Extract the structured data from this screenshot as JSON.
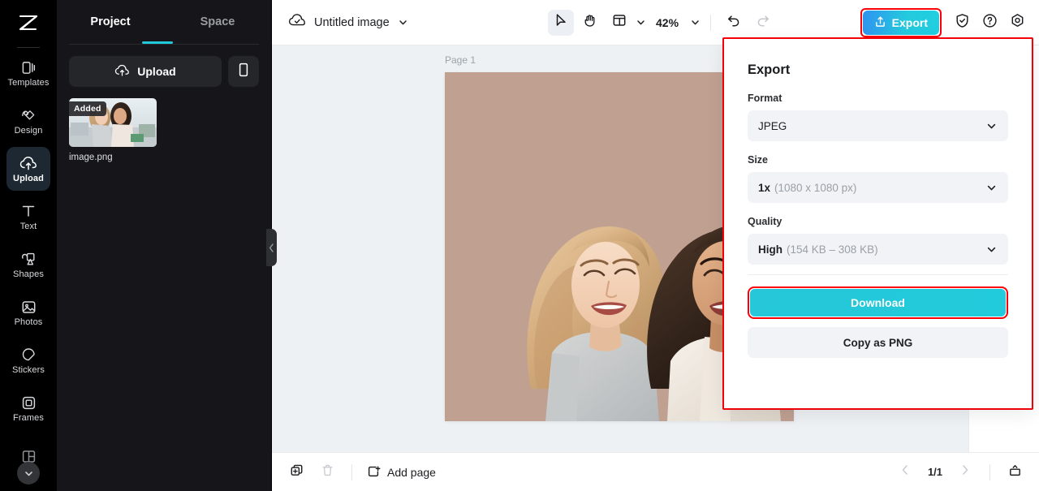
{
  "app": {
    "logo": "capcut-logo",
    "accent_cyan": "#21c9da",
    "accent_blue": "#2f93f0",
    "highlight_red": "#fb0007"
  },
  "rail": {
    "items": [
      {
        "label": "Templates",
        "icon": "templates-icon",
        "active": false
      },
      {
        "label": "Design",
        "icon": "design-icon",
        "active": false
      },
      {
        "label": "Upload",
        "icon": "upload-cloud-icon",
        "active": true
      },
      {
        "label": "Text",
        "icon": "text-icon",
        "active": false
      },
      {
        "label": "Shapes",
        "icon": "shapes-icon",
        "active": false
      },
      {
        "label": "Photos",
        "icon": "photos-icon",
        "active": false
      },
      {
        "label": "Stickers",
        "icon": "stickers-icon",
        "active": false
      },
      {
        "label": "Frames",
        "icon": "frames-icon",
        "active": false
      },
      {
        "label": "",
        "icon": "layouts-icon",
        "active": false
      }
    ],
    "more_icon": "chevron-down-icon"
  },
  "panel": {
    "tabs": [
      {
        "label": "Project",
        "active": true
      },
      {
        "label": "Space",
        "active": false
      }
    ],
    "upload_button": "Upload",
    "upload_icon": "upload-cloud-icon",
    "mobile_icon": "mobile-phone-icon",
    "assets": [
      {
        "name": "image.png",
        "badge": "Added"
      }
    ],
    "collapse_icon": "chevron-left-icon"
  },
  "topbar": {
    "cloud_icon": "cloud-saved-icon",
    "doc_title": "Untitled image",
    "title_caret": "chevron-down-icon",
    "tools": [
      {
        "icon": "cursor-select-icon",
        "active": true
      },
      {
        "icon": "hand-pan-icon",
        "active": false
      },
      {
        "icon": "layout-grid-icon",
        "active": false
      }
    ],
    "layout_caret": "chevron-down-icon",
    "zoom_level": "42%",
    "zoom_caret": "chevron-down-icon",
    "undo_icon": "undo-icon",
    "redo_icon": "redo-icon",
    "export_label": "Export",
    "export_icon": "share-upload-icon",
    "export_highlighted": true,
    "right_icons": [
      {
        "icon": "shield-check-icon"
      },
      {
        "icon": "help-question-icon"
      },
      {
        "icon": "settings-gear-icon"
      }
    ]
  },
  "canvas": {
    "page_label": "Page 1",
    "background_color": "#eef1f3",
    "artboard_color": "#c0a091"
  },
  "bottombar": {
    "duplicate_icon": "duplicate-page-icon",
    "delete_icon": "trash-icon",
    "add_page_icon": "add-page-icon",
    "add_page_label": "Add page",
    "prev_icon": "chevron-left-icon",
    "page_counter": "1/1",
    "next_icon": "chevron-right-icon",
    "present_icon": "present-icon"
  },
  "export_panel": {
    "title": "Export",
    "format": {
      "label": "Format",
      "value": "JPEG",
      "caret": "chevron-down-icon"
    },
    "size": {
      "label": "Size",
      "value_main": "1x",
      "value_sub": "(1080 x 1080 px)",
      "caret": "chevron-down-icon"
    },
    "quality": {
      "label": "Quality",
      "value_main": "High",
      "value_sub": "(154 KB – 308 KB)",
      "caret": "chevron-down-icon"
    },
    "download_label": "Download",
    "download_highlighted": true,
    "copy_label": "Copy as PNG",
    "panel_highlighted": true
  }
}
